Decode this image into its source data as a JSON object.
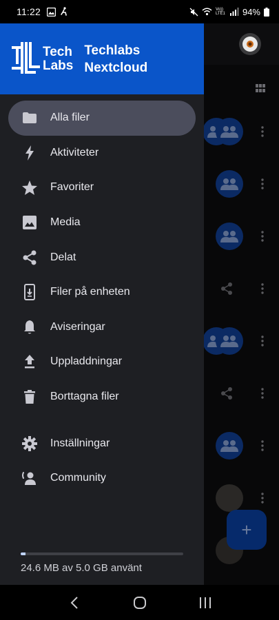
{
  "status_bar": {
    "time": "11:22",
    "battery": "94%",
    "network_label": "Vo)) LTE1"
  },
  "drawer": {
    "logo_line1": "Tech",
    "logo_line2": "Labs",
    "title_line1": "Techlabs",
    "title_line2": "Nextcloud",
    "menu_items": [
      {
        "label": "Alla filer",
        "icon": "folder-icon",
        "active": true
      },
      {
        "label": "Aktiviteter",
        "icon": "lightning-icon"
      },
      {
        "label": "Favoriter",
        "icon": "star-icon"
      },
      {
        "label": "Media",
        "icon": "image-icon"
      },
      {
        "label": "Delat",
        "icon": "share-icon"
      },
      {
        "label": "Filer på enheten",
        "icon": "phone-download-icon"
      },
      {
        "label": "Aviseringar",
        "icon": "bell-icon"
      },
      {
        "label": "Uppladdningar",
        "icon": "upload-icon"
      },
      {
        "label": "Borttagna filer",
        "icon": "trash-icon"
      }
    ],
    "secondary_items": [
      {
        "label": "Inställningar",
        "icon": "gear-icon"
      },
      {
        "label": "Community",
        "icon": "community-icon"
      }
    ],
    "quota": {
      "text": "24.6 MB av 5.0 GB använt",
      "fraction": 0.005
    }
  },
  "colors": {
    "header_blue": "#0a55c9",
    "drawer_bg": "#1e1f23",
    "active_item": "#4b4d5c",
    "fab": "#062a6b"
  },
  "fab": {
    "label": "+"
  }
}
